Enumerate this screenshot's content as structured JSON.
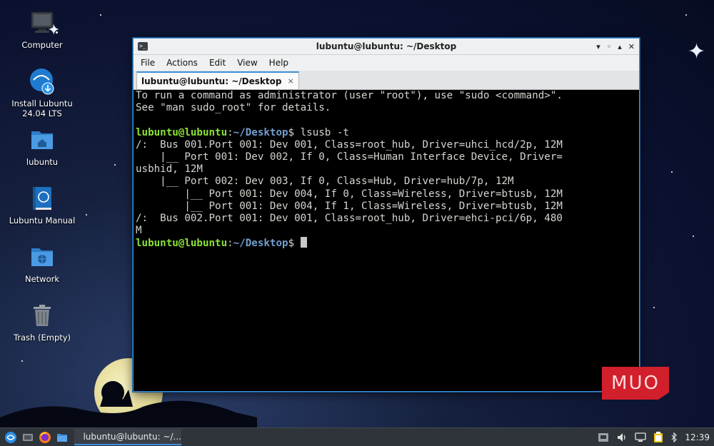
{
  "desktop": {
    "icons": [
      {
        "label": "Computer"
      },
      {
        "label": "Install Lubuntu 24.04 LTS"
      },
      {
        "label": "lubuntu"
      },
      {
        "label": "Lubuntu Manual"
      },
      {
        "label": "Network"
      },
      {
        "label": "Trash (Empty)"
      }
    ]
  },
  "window": {
    "title": "lubuntu@lubuntu: ~/Desktop",
    "menu": [
      "File",
      "Actions",
      "Edit",
      "View",
      "Help"
    ],
    "tab_label": "lubuntu@lubuntu: ~/Desktop",
    "tab_close_glyph": "×",
    "controls": {
      "minimize": "▾",
      "maximize": "◦",
      "restore": "▴",
      "close": "✕"
    }
  },
  "terminal": {
    "lines": [
      "To run a command as administrator (user \"root\"), use \"sudo <command>\".",
      "See \"man sudo_root\" for details.",
      "",
      "/:  Bus 001.Port 001: Dev 001, Class=root_hub, Driver=uhci_hcd/2p, 12M",
      "    |__ Port 001: Dev 002, If 0, Class=Human Interface Device, Driver=",
      "usbhid, 12M",
      "    |__ Port 002: Dev 003, If 0, Class=Hub, Driver=hub/7p, 12M",
      "        |__ Port 001: Dev 004, If 0, Class=Wireless, Driver=btusb, 12M",
      "        |__ Port 001: Dev 004, If 1, Class=Wireless, Driver=btusb, 12M",
      "/:  Bus 002.Port 001: Dev 001, Class=root_hub, Driver=ehci-pci/6p, 480",
      "M"
    ],
    "prompt_user": "lubuntu@lubuntu",
    "prompt_sep": ":",
    "prompt_path": "~/Desktop",
    "prompt_symbol": "$ ",
    "command": "lsusb -t"
  },
  "watermark": "MUO",
  "taskbar": {
    "task_label": "lubuntu@lubuntu: ~/...",
    "clock": "12:39"
  },
  "colors": {
    "accent": "#3d8fd6",
    "prompt_user": "#8ae234",
    "prompt_path": "#729fcf",
    "terminal_fg": "#d3d7cf"
  }
}
